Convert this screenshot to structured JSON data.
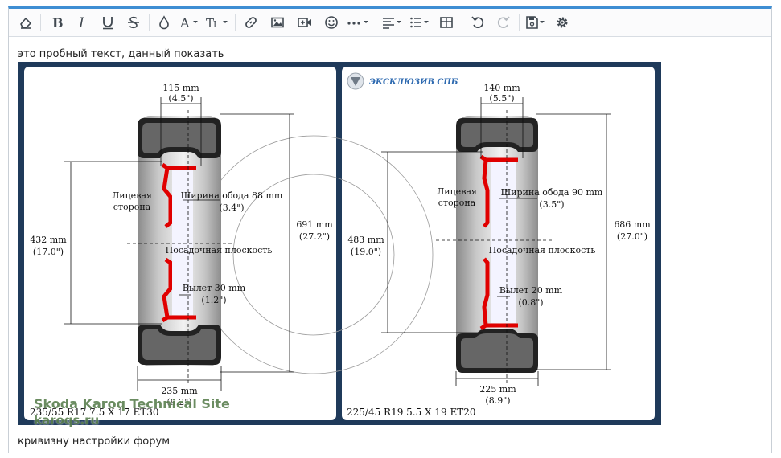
{
  "editor": {
    "toolbar": {
      "buttons": [
        {
          "name": "clear-format-button",
          "icon": "eraser-icon"
        },
        {
          "name": "bold-button",
          "icon": "bold-icon"
        },
        {
          "name": "italic-button",
          "icon": "italic-icon"
        },
        {
          "name": "underline-button",
          "icon": "underline-icon"
        },
        {
          "name": "strikethrough-button",
          "icon": "strikethrough-icon"
        },
        {
          "name": "text-color-button",
          "icon": "droplet-icon"
        },
        {
          "name": "font-family-button",
          "icon": "font-icon"
        },
        {
          "name": "font-size-button",
          "icon": "text-height-icon"
        },
        {
          "name": "link-button",
          "icon": "link-icon"
        },
        {
          "name": "image-button",
          "icon": "image-icon"
        },
        {
          "name": "video-button",
          "icon": "video-icon"
        },
        {
          "name": "emoji-button",
          "icon": "smile-icon"
        },
        {
          "name": "more-button",
          "icon": "ellipsis-icon"
        },
        {
          "name": "align-button",
          "icon": "align-left-icon"
        },
        {
          "name": "list-button",
          "icon": "list-icon"
        },
        {
          "name": "table-button",
          "icon": "table-icon"
        },
        {
          "name": "undo-button",
          "icon": "undo-icon"
        },
        {
          "name": "redo-button",
          "icon": "redo-icon"
        },
        {
          "name": "save-draft-button",
          "icon": "save-icon"
        },
        {
          "name": "settings-button",
          "icon": "gear-icon"
        }
      ]
    },
    "content": {
      "line1": "это пробный текст, данный показать",
      "line2": "кривизну настройки форум"
    }
  },
  "image": {
    "watermark": {
      "line1": "Skoda Karoq Technical Site",
      "line2": "karoqs.ru"
    },
    "logo_text": "ЭКСКЛЮЗИВ СПБ",
    "left": {
      "width_top": "115 mm",
      "width_top_in": "(4.5\")",
      "rim_width": "Ширина обода 88 mm",
      "rim_width_in": "(3.4\")",
      "face_label_1": "Лицевая",
      "face_label_2": "сторона",
      "rim_diam": "432 mm",
      "rim_diam_in": "(17.0\")",
      "seat_plane": "Посадочная плоскость",
      "offset": "Вылет 30 mm",
      "offset_in": "(1.2\")",
      "overall": "691 mm",
      "overall_in": "(27.2\")",
      "tire_width": "235 mm",
      "tire_width_in": "(9.2\")",
      "spec": "235/55 R17   7.5 X 17 ET30"
    },
    "right": {
      "width_top": "140 mm",
      "width_top_in": "(5.5\")",
      "rim_width": "Ширина обода 90 mm",
      "rim_width_in": "(3.5\")",
      "face_label_1": "Лицевая",
      "face_label_2": "сторона",
      "rim_diam": "483 mm",
      "rim_diam_in": "(19.0\")",
      "seat_plane": "Посадочная плоскость",
      "offset": "Вылет 20 mm",
      "offset_in": "(0.8\")",
      "overall": "686 mm",
      "overall_in": "(27.0\")",
      "tire_width": "225 mm",
      "tire_width_in": "(8.9\")",
      "spec": "225/45 R19   5.5 X 19 ET20"
    }
  }
}
